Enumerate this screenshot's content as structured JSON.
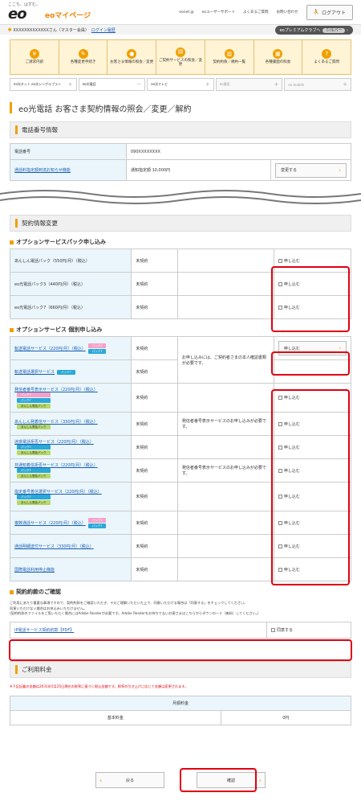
{
  "header": {
    "tagline": "ここち、はずむ。",
    "logo": "eo",
    "mypage": "eoマイページ",
    "links": [
      "eonet.jp",
      "eoユーザーサポート",
      "よくあるご質問",
      "お問い合わせ"
    ],
    "logout": "ログアウト"
  },
  "userbar": {
    "user": "XXXXXXXXXXXXXさん（マスター会員）",
    "history": "ログイン履歴",
    "premium": "eoプレミアムクラブへ",
    "rank": "シルバー"
  },
  "nav": [
    "ご請求内訳",
    "各種変更手続き",
    "お客さま情報の照会／変更",
    "ご契約サービスの照会／変更",
    "契約約款／規約一覧",
    "各種書面の照会",
    "よくあるご質問"
  ],
  "services": [
    "eo光ネット eo光シングルプラン",
    "eo光電話",
    "eo光テレビ",
    "eo電気",
    "eo mobile"
  ],
  "title": "eo光電話 お客さま契約情報の照会／変更／解約",
  "phone_section": {
    "heading": "電話番号情報",
    "rows": [
      {
        "label": "電話番号",
        "value": "090XXXXXXXX"
      },
      {
        "label": "通話料指定額到達お知らせ機能",
        "value": "通知指定額 10,000円",
        "button": "変更する"
      }
    ]
  },
  "contract_section": "契約情報変更",
  "pack": {
    "heading": "オプションサービスパック申し込み",
    "rows": [
      {
        "name": "あんしん電話パック（550円/月）（税込）",
        "status": "未契約",
        "action": "申し込む"
      },
      {
        "name": "eo光電話パック3（440円/月）（税込）",
        "status": "未契約",
        "action": "申し込む"
      },
      {
        "name": "eo光電話パック7（660円/月）（税込）",
        "status": "未契約",
        "action": "申し込む"
      }
    ]
  },
  "individual": {
    "heading": "オプションサービス 個別申し込み",
    "tags": {
      "p3": "パック3",
      "p7": "パック7",
      "an": "あんしん電話パック"
    },
    "rows": [
      {
        "name": "転送電話サービス（220円/月）（税込）",
        "status": "未契約",
        "note": "お申し込みには、ご契約者さまの本人確認書類が必要です。",
        "button": "申し込む"
      },
      {
        "name": "転送電話選択サービス",
        "status": "未契約",
        "note": ""
      },
      {
        "name": "発信者番号表示サービス（220円/月）（税込）",
        "status": "未契約",
        "note": "",
        "action": "申し込む"
      },
      {
        "name": "あんしん発着信サービス（330円/月）（税込）",
        "status": "未契約",
        "note": "発信者番号表示サービスのお申し込みが必要です。",
        "action": "申し込む"
      },
      {
        "name": "迷惑電話拒否サービス（220円/月）（税込）",
        "status": "未契約",
        "note": "",
        "action": "申し込む"
      },
      {
        "name": "非通知着信拒否サービス（220円/月）（税込）",
        "status": "未契約",
        "note": "発信者番号表示サービスのお申し込みが必要です。",
        "action": "申し込む"
      },
      {
        "name": "指定番号着信選択サービス（220円/月）（税込）",
        "status": "未契約",
        "note": "",
        "action": "申し込む"
      },
      {
        "name": "複数通話サービス（220円/月）（税込）",
        "status": "未契約",
        "note": "",
        "action": "申し込む"
      },
      {
        "name": "通話明細送付サービス（330円/月）（税込）",
        "status": "未契約",
        "note": "",
        "action": "申し込む"
      },
      {
        "name": "国際電話利用停止機能",
        "status": "未契約",
        "note": "",
        "action": "申し込む"
      }
    ]
  },
  "terms": {
    "heading": "契約約款のご確認",
    "note1": "ご利用にあたり重要な事項ですので、契約約款をご確認いただき、十分ご理解いただいた上で、同意いただける場合は「同意する」をチェックしてください。",
    "note2": "同意いただけない場合はお申込みいただけません。",
    "note3": "(契約約款のファイルをご覧いただく場合にはAdobe Readerが必要です。Adobe Readerをお持ちでないお客さまはこちらからダウンロード（無料）してください。)",
    "link": "IP電話サービス契約約款【PDF】",
    "agree": "同意する"
  },
  "fee": {
    "heading": "ご利用料金",
    "note": "※下記記載の金額は2031年5月25日現在の税率に基づく税込金額です。税率の引き上げに応じて金額は変更されます。",
    "col": "月額料金",
    "row_label": "基本料金",
    "row_value": "0円"
  },
  "actions": {
    "back": "戻る",
    "confirm": "確認"
  }
}
